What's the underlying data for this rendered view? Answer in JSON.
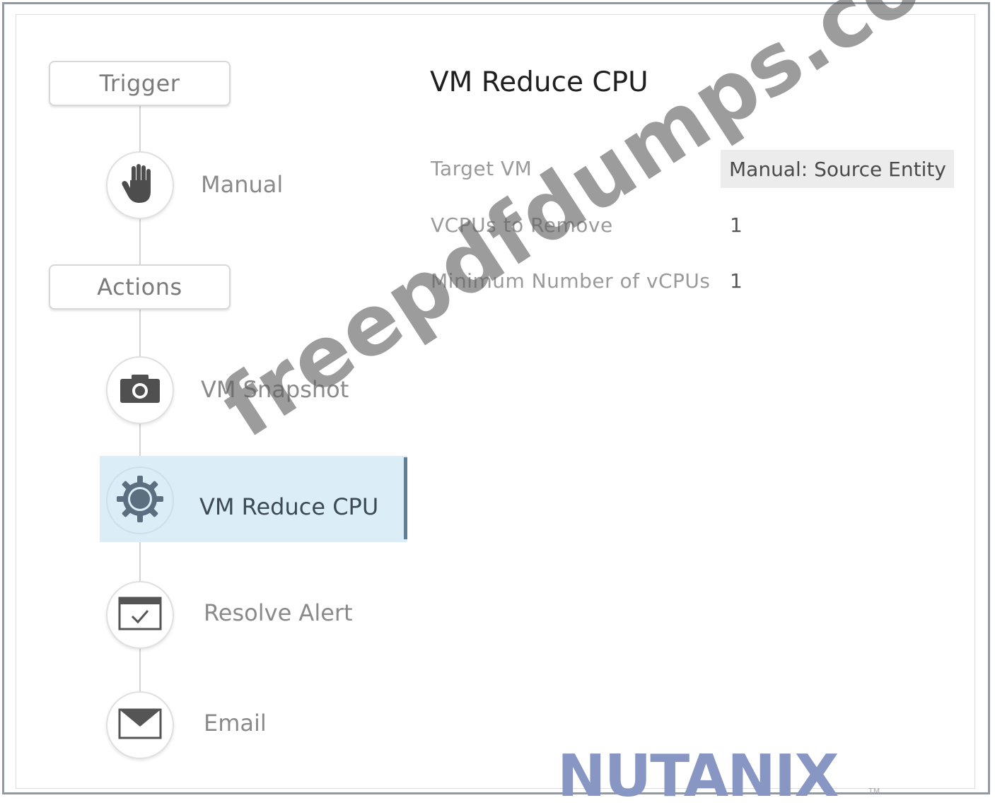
{
  "sections": {
    "trigger_label": "Trigger",
    "actions_label": "Actions"
  },
  "trigger": {
    "label": "Manual",
    "icon": "hand-icon"
  },
  "actions": [
    {
      "label": "VM Snapshot",
      "icon": "camera-icon",
      "selected": false
    },
    {
      "label": "VM Reduce CPU",
      "icon": "gear-icon",
      "selected": true
    },
    {
      "label": "Resolve Alert",
      "icon": "checkbox-window-icon",
      "selected": false
    },
    {
      "label": "Email",
      "icon": "envelope-icon",
      "selected": false
    }
  ],
  "detail": {
    "title": "VM Reduce CPU",
    "fields": [
      {
        "label": "Target VM",
        "value": "Manual:  Source Entity"
      },
      {
        "label": "VCPUs to Remove",
        "value": "1"
      },
      {
        "label": "Minimum  Number  of  vCPUs",
        "value": "1"
      }
    ]
  },
  "watermark": "freepdfdumps.com",
  "logo": {
    "text": "NUTANIX",
    "tm": "TM"
  },
  "colors": {
    "selected_bg": "#dbeef8",
    "selected_bar": "#5f7f99",
    "logo": "#8896c4"
  }
}
